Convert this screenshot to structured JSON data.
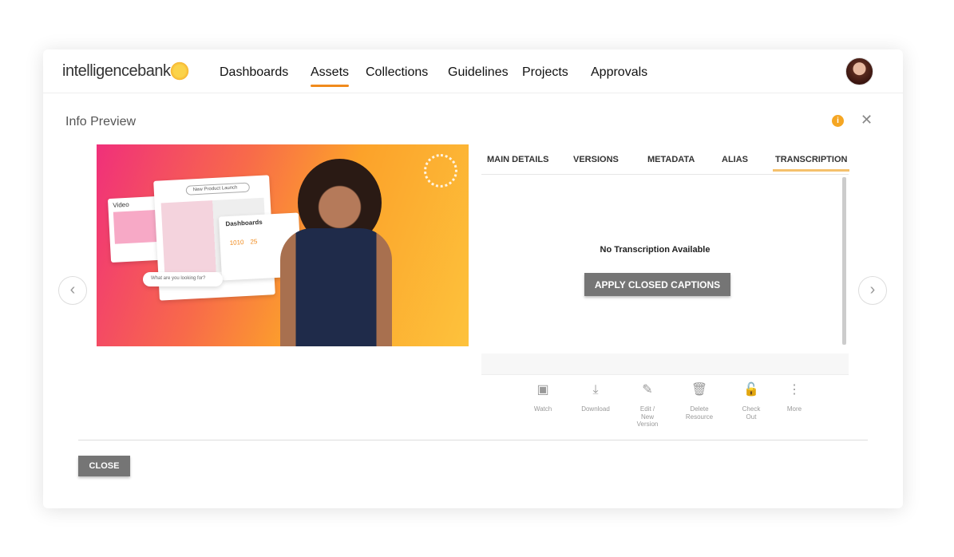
{
  "header": {
    "logo": "intelligencebank",
    "nav": [
      "Dashboards",
      "Assets",
      "Collections",
      "Guidelines",
      "Projects",
      "Approvals"
    ],
    "active": "Assets"
  },
  "preview": {
    "title": "Info Preview",
    "info_icon": "info-icon",
    "close_icon": "close-icon"
  },
  "thumbnail": {
    "mock_video": "Video",
    "mock_search1": "New Product Launch",
    "mock_dashboards": "Dashboards",
    "mock_val1": "1010",
    "mock_val2": "25",
    "mock_search2": "What are you looking for?"
  },
  "tabs": [
    "MAIN DETAILS",
    "VERSIONS",
    "METADATA",
    "ALIAS",
    "TRANSCRIPTION"
  ],
  "active_tab": "TRANSCRIPTION",
  "transcription": {
    "empty": "No Transcription Available",
    "button": "APPLY CLOSED CAPTIONS"
  },
  "actions": [
    {
      "icon": "watch-icon",
      "label": "Watch"
    },
    {
      "icon": "download-icon",
      "label": "Download"
    },
    {
      "icon": "edit-icon",
      "label": "Edit / New Version"
    },
    {
      "icon": "trash-icon",
      "label": "Delete Resource"
    },
    {
      "icon": "lock-icon",
      "label": "Check Out"
    },
    {
      "icon": "more-icon",
      "label": "More"
    }
  ],
  "footer": {
    "close": "CLOSE"
  },
  "colors": {
    "accent": "#f08a1c",
    "button": "#757575",
    "info": "#f5a623"
  }
}
